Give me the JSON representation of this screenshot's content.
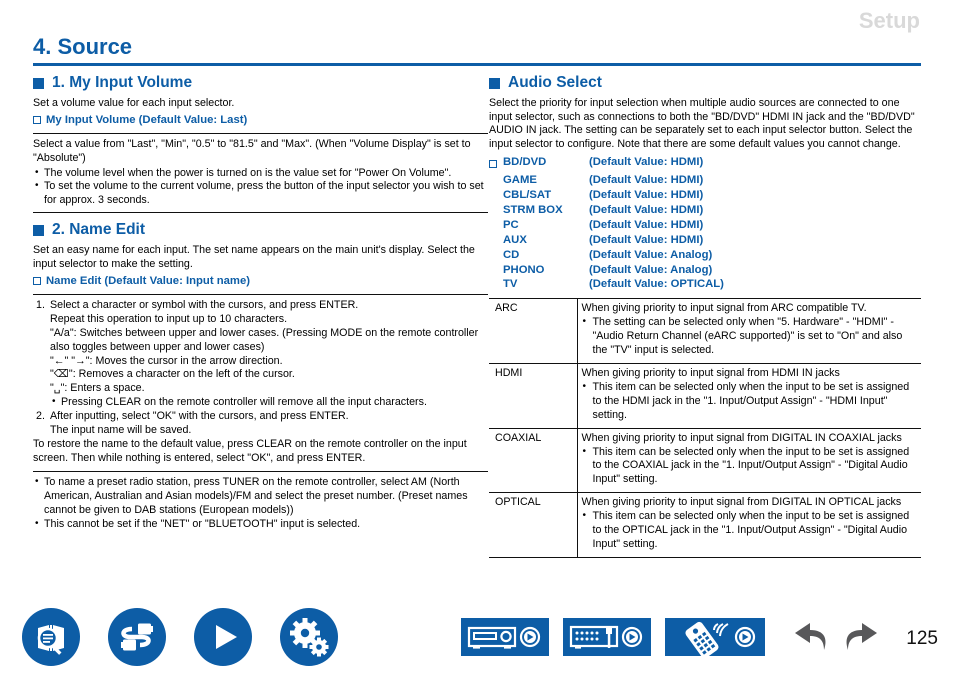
{
  "header": {
    "section_label": "Setup",
    "chapter_title": "4. Source"
  },
  "left_column": {
    "section1": {
      "heading": "1. My Input Volume",
      "intro": "Set a volume value for each input selector.",
      "subheading": "My Input Volume (Default Value: Last)",
      "body_line1": "Select a value from \"Last\", \"Min\", \"0.5\" to \"81.5\" and \"Max\". (When \"Volume Display\" is set to \"Absolute\")",
      "bullets": [
        "The volume level when the power is turned on is the value set for \"Power On Volume\".",
        "To set the volume to the current volume, press the button of the input selector you wish to set for approx. 3 seconds."
      ]
    },
    "section2": {
      "heading": "2. Name Edit",
      "intro": "Set an easy name for each input. The set name appears on the main unit's display. Select the input selector to make the setting.",
      "subheading": "Name Edit (Default Value: Input name)",
      "step1_num": "1.",
      "step1_text": "Select a character or symbol with the cursors, and press ENTER.",
      "step1_lines": [
        "Repeat this operation to input up to 10 characters.",
        "\"A/a\": Switches between upper and lower cases. (Pressing MODE on the remote controller also toggles between upper and lower cases)",
        "\"←\" \"→\": Moves the cursor in the arrow direction.",
        "\"⌫\": Removes a character on the left of the cursor.",
        "\"␣\": Enters a space."
      ],
      "step1_bullet": "Pressing CLEAR on the remote controller will remove all the input characters.",
      "step2_num": "2.",
      "step2_text": "After inputting, select \"OK\" with the cursors, and press ENTER.",
      "step2_sub": "The input name will be saved.",
      "restore_text": "To restore the name to the default value, press CLEAR on the remote controller on the input screen. Then while nothing is entered, select \"OK\", and press ENTER.",
      "notes": [
        "To name a preset radio station, press TUNER on the remote controller, select AM (North American, Australian and Asian models)/FM and select the preset number. (Preset names cannot be given to DAB stations (European models))",
        "This cannot be set if the \"NET\" or \"BLUETOOTH\" input is selected."
      ]
    }
  },
  "right_column": {
    "heading": "Audio Select",
    "intro": "Select the priority for input selection when multiple audio sources are connected to one input selector, such as connections to both the \"BD/DVD\" HDMI IN jack and the \"BD/DVD\" AUDIO IN jack. The setting can be separately set to each input selector button. Select the input selector to configure. Note that there are some default values you cannot change.",
    "defaults": [
      {
        "name": "BD/DVD",
        "value": "(Default Value: HDMI)"
      },
      {
        "name": "GAME",
        "value": "(Default Value: HDMI)"
      },
      {
        "name": "CBL/SAT",
        "value": "(Default Value: HDMI)"
      },
      {
        "name": "STRM BOX",
        "value": "(Default Value: HDMI)"
      },
      {
        "name": "PC",
        "value": "(Default Value: HDMI)"
      },
      {
        "name": "AUX",
        "value": "(Default Value: HDMI)"
      },
      {
        "name": "CD",
        "value": "(Default Value: Analog)"
      },
      {
        "name": "PHONO",
        "value": "(Default Value: Analog)"
      },
      {
        "name": "TV",
        "value": "(Default Value: OPTICAL)"
      }
    ],
    "table": [
      {
        "name": "ARC",
        "desc": "When giving priority to input signal from ARC compatible TV.",
        "bullet": "The setting can be selected only when \"5. Hardware\" - \"HDMI\" - \"Audio Return Channel (eARC supported)\" is set to \"On\" and also the \"TV\" input is selected."
      },
      {
        "name": "HDMI",
        "desc": "When giving priority to input signal from HDMI IN jacks",
        "bullet": "This item can be selected only when the input to be set is assigned to the HDMI jack in the \"1. Input/Output Assign\" - \"HDMI Input\" setting."
      },
      {
        "name": "COAXIAL",
        "desc": "When giving priority to input signal from DIGITAL IN COAXIAL jacks",
        "bullet": "This item can be selected only when the input to be set is assigned to the COAXIAL jack in the \"1. Input/Output Assign\" - \"Digital Audio Input\" setting."
      },
      {
        "name": "OPTICAL",
        "desc": "When giving priority to input signal from DIGITAL IN OPTICAL jacks",
        "bullet": "This item can be selected only when the input to be set is assigned to the OPTICAL jack in the \"1. Input/Output Assign\" - \"Digital Audio Input\" setting."
      }
    ]
  },
  "footer": {
    "round_buttons": [
      "manual-search-icon",
      "connections-icon",
      "playback-icon",
      "setup-gears-icon"
    ],
    "panel_buttons": [
      "front-panel-icon",
      "rear-panel-icon",
      "remote-controller-icon"
    ],
    "nav": [
      "undo-arrow-icon",
      "redo-arrow-icon"
    ],
    "page_number": "125"
  },
  "colors": {
    "brand_blue": "#0d5da6",
    "header_gray": "#d9d9d9",
    "nav_gray": "#58585a"
  }
}
